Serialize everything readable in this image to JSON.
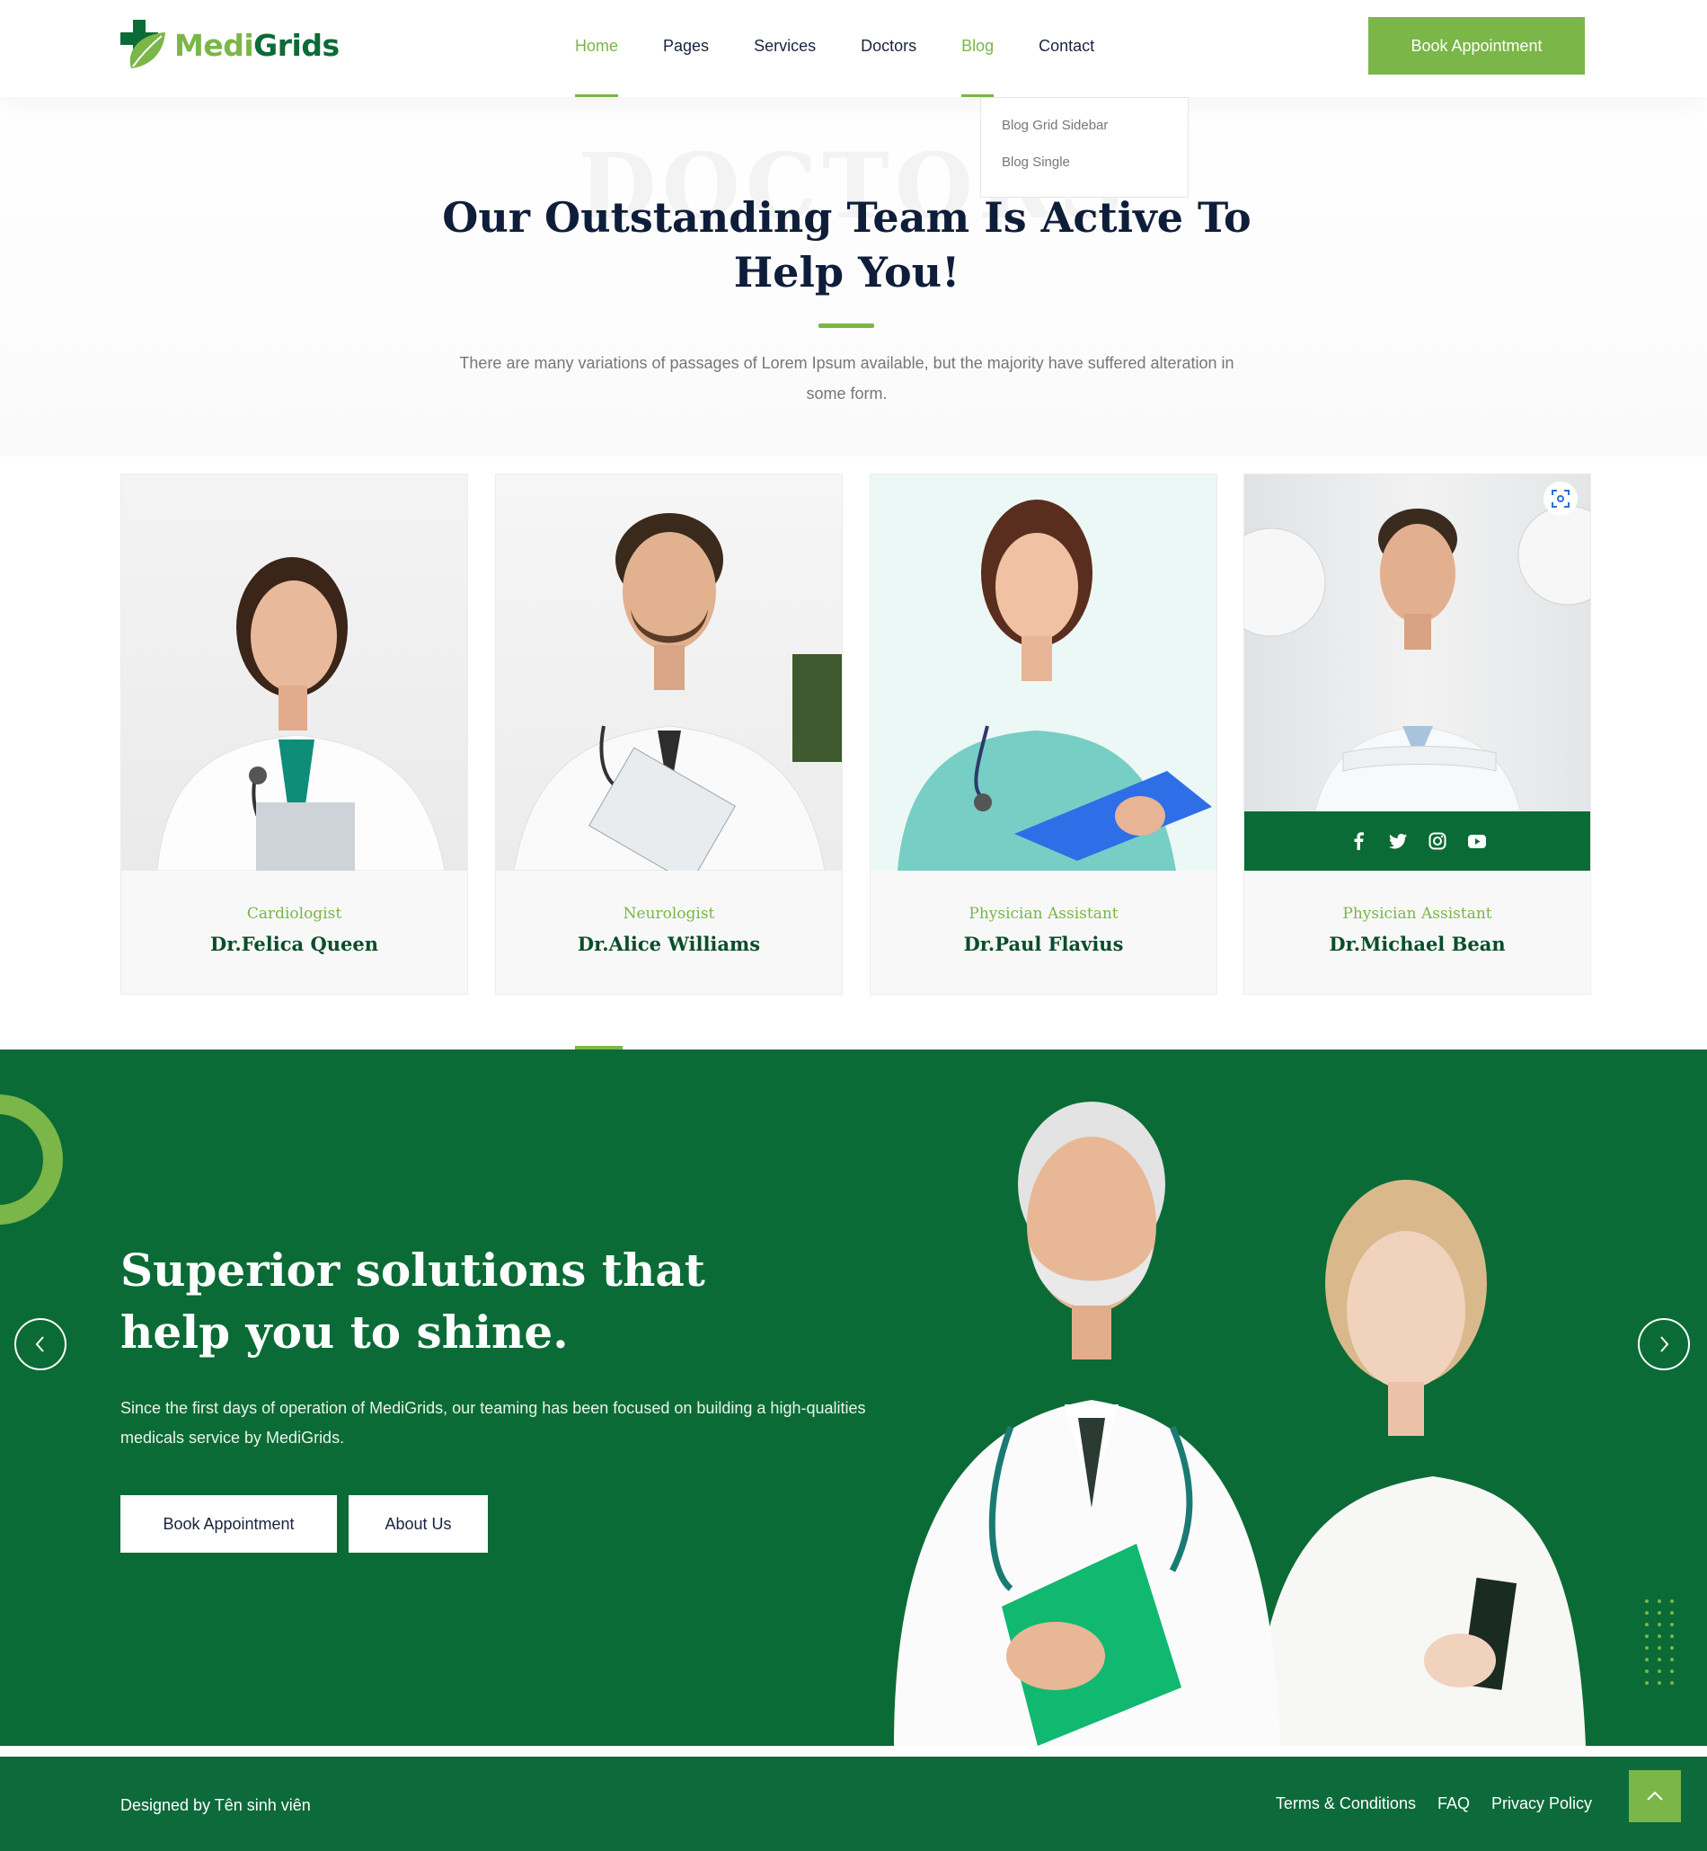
{
  "brand": {
    "name_part1": "Medi",
    "name_part2": "Grids",
    "accent": "#7ab648",
    "dark_green": "#0b6b36",
    "navy": "#0e1e3a"
  },
  "nav": {
    "items": [
      {
        "label": "Home",
        "active": true
      },
      {
        "label": "Pages"
      },
      {
        "label": "Services"
      },
      {
        "label": "Doctors"
      },
      {
        "label": "Blog",
        "active": true
      },
      {
        "label": "Contact"
      }
    ],
    "cta": "Book Appointment"
  },
  "blog_dropdown": [
    "Blog Grid Sidebar",
    "Blog Single"
  ],
  "team": {
    "ghost_text": "DOCTORS",
    "title": "Our Outstanding Team Is Active To Help You!",
    "description": "There are many variations of passages of Lorem Ipsum available, but the majority have suffered alteration in some form."
  },
  "doctors": [
    {
      "role": "Cardiologist",
      "name": "Dr.Felica Queen",
      "photo_icon": "female-doctor-photo"
    },
    {
      "role": "Neurologist",
      "name": "Dr.Alice Williams",
      "photo_icon": "male-doctor-photo"
    },
    {
      "role": "Physician Assistant",
      "name": "Dr.Paul Flavius",
      "photo_icon": "female-nurse-photo"
    },
    {
      "role": "Physician Assistant",
      "name": "Dr.Michael Bean",
      "photo_icon": "male-doctor-photo",
      "hovered": true
    }
  ],
  "social_icons": [
    "facebook-icon",
    "twitter-icon",
    "instagram-icon",
    "youtube-icon"
  ],
  "hero": {
    "title": "Superior solutions that help you to shine.",
    "description": "Since the first days of operation of MediGrids, our teaming has been focused on building a high-qualities medicals service by MediGrids.",
    "primary_button": "Book Appointment",
    "secondary_button": "About Us",
    "image_icon": "two-doctors-photo"
  },
  "footer": {
    "credit": "Designed by Tên sinh viên",
    "links": [
      "Terms & Conditions",
      "FAQ",
      "Privacy Policy"
    ]
  }
}
